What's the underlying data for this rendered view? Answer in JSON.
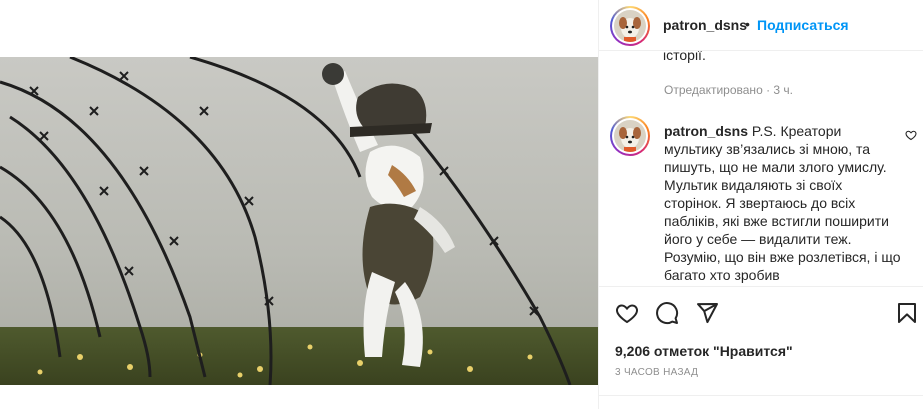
{
  "header": {
    "username": "patron_dsns",
    "separator": "•",
    "follow_label": "Подписаться"
  },
  "comments": {
    "previous_tail": "історії.",
    "edited_label": "Отредактировано · 3 ч.",
    "items": [
      {
        "username": "patron_dsns",
        "text": " P.S. Креатори мультику зв’язались зі мною, та пишуть, що не мали злого умислу. Мультик видаляють зі своїх сторінок. Я звертаюсь до всіх пабліків, які вже встигли поширити його у себе — видалити теж. Розумію, що він вже розлетівся, і що багато хто зробив"
      }
    ]
  },
  "actions": {
    "like_icon": "heart-icon",
    "comment_icon": "comment-icon",
    "share_icon": "paper-plane-icon",
    "save_icon": "bookmark-icon"
  },
  "likes_label": "9,206 отметок \"Нравится\"",
  "time_label": "3 часов назад",
  "colors": {
    "accent": "#0095f6",
    "muted": "#8e8e8e",
    "text": "#262626",
    "border": "#efefef"
  }
}
